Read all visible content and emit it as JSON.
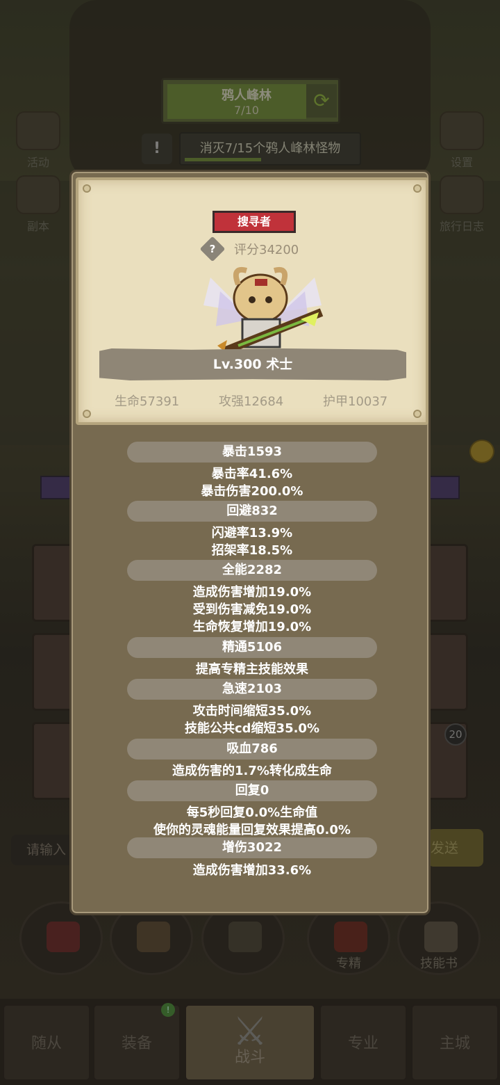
{
  "scene": {
    "stage": {
      "title": "鸦人峰林",
      "progress": "7/10"
    },
    "quest": {
      "text": "消灭7/15个鸦人峰林怪物",
      "alert": "!"
    },
    "left_buttons": [
      "活动",
      "副本"
    ],
    "right_buttons": [
      "设置",
      "旅行日志"
    ],
    "chat": {
      "input_placeholder": "请输入",
      "send_label": "发送"
    },
    "monster_badge": "20",
    "skill_buttons": [
      "专精",
      "技能书"
    ],
    "nav_tabs": [
      "随从",
      "装备",
      "战斗",
      "专业",
      "主城"
    ],
    "active_tab": "战斗"
  },
  "popup": {
    "role_badge": "搜寻者",
    "score_help_icon": "?",
    "score": "评分34200",
    "name_level": "Lv.300 术士",
    "base_stats": [
      "生命57391",
      "攻强12684",
      "护甲10037"
    ],
    "stat_groups": [
      {
        "header": "暴击1593",
        "lines": [
          "暴击率41.6%",
          "暴击伤害200.0%"
        ]
      },
      {
        "header": "回避832",
        "lines": [
          "闪避率13.9%",
          "招架率18.5%"
        ]
      },
      {
        "header": "全能2282",
        "lines": [
          "造成伤害增加19.0%",
          "受到伤害减免19.0%",
          "生命恢复增加19.0%"
        ]
      },
      {
        "header": "精通5106",
        "lines": [
          "提高专精主技能效果"
        ]
      },
      {
        "header": "急速2103",
        "lines": [
          "攻击时间缩短35.0%",
          "技能公共cd缩短35.0%"
        ]
      },
      {
        "header": "吸血786",
        "lines": [
          "造成伤害的1.7%转化成生命"
        ]
      },
      {
        "header": "回复0",
        "lines": [
          "每5秒回复0.0%生命值",
          "使你的灵魂能量回复效果提高0.0%"
        ]
      },
      {
        "header": "增伤3022",
        "lines": [
          "造成伤害增加33.6%"
        ]
      }
    ]
  }
}
